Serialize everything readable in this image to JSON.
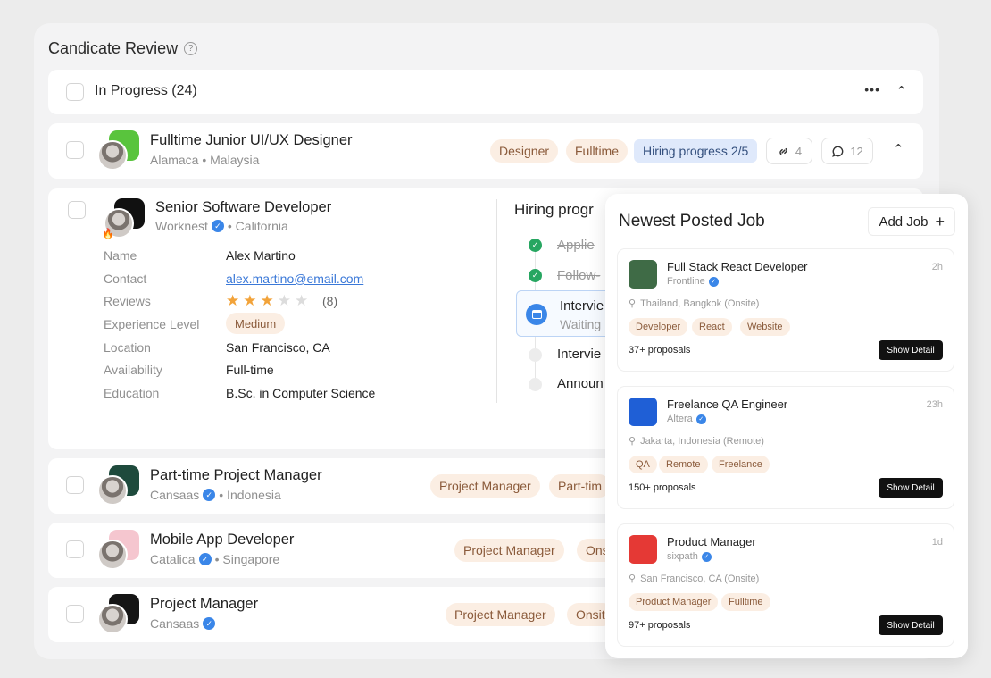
{
  "header": {
    "title": "Candicate Review",
    "help_icon": "?"
  },
  "group": {
    "label": "In Progress (24)",
    "more_icon": "•••",
    "collapse_icon": "⌃"
  },
  "featured": {
    "title": "Fulltime Junior UI/UX Designer",
    "subtitle": "Alamaca • Malaysia",
    "tags": [
      "Designer",
      "Fulltime"
    ],
    "hiring_progress": "Hiring progress 2/5",
    "link_count": "4",
    "comment_count": "12",
    "logo_color": "#59c43d"
  },
  "candidate": {
    "job_title": "Senior Software Developer",
    "company": "Worknest",
    "location": "• California",
    "fields": [
      {
        "label": "Name",
        "value": "Alex Martino"
      },
      {
        "label": "Contact",
        "value": "alex.martino@email.com"
      },
      {
        "label": "Reviews",
        "value": "(8)"
      },
      {
        "label": "Experience Level",
        "value": "Medium"
      },
      {
        "label": "Location",
        "value": "San Francisco, CA"
      },
      {
        "label": "Availability",
        "value": "Full-time"
      },
      {
        "label": "Education",
        "value": "B.Sc. in Computer Science"
      }
    ],
    "rating": 3,
    "rating_max": 5,
    "hiring_title": "Hiring progr",
    "steps": [
      {
        "label": "Applie",
        "status": "done"
      },
      {
        "label": "Follow-",
        "status": "done"
      },
      {
        "label": "Intervie",
        "sub": "Waiting",
        "status": "current"
      },
      {
        "label": "Intervie",
        "status": "pending"
      },
      {
        "label": "Announ",
        "status": "pending"
      }
    ]
  },
  "rows": [
    {
      "title": "Part-time Project Manager",
      "company": "Cansaas",
      "location": "• Indonesia",
      "tags": [
        "Project Manager",
        "Part-tim"
      ],
      "logo_color": "#1e4a3c"
    },
    {
      "title": "Mobile App Developer",
      "company": "Catalica",
      "location": "• Singapore",
      "tags": [
        "Project Manager",
        "Ons"
      ],
      "logo_color": "#f5c6cf"
    },
    {
      "title": "Project Manager",
      "company": "Cansaas",
      "location": "",
      "tags": [
        "Project Manager",
        "Onsit"
      ],
      "logo_color": "#151515"
    }
  ],
  "panel": {
    "title": "Newest Posted Job",
    "add_label": "Add Job",
    "add_icon": "+",
    "jobs": [
      {
        "title": "Full Stack React Developer",
        "company": "Frontline",
        "time": "2h",
        "location": "Thailand, Bangkok (Onsite)",
        "tags": [
          "Developer",
          "React",
          "Website"
        ],
        "proposals": "37+ proposals",
        "button": "Show Detail",
        "logo_color": "#3f6b46"
      },
      {
        "title": "Freelance QA Engineer",
        "company": "Altera",
        "time": "23h",
        "location": "Jakarta, Indonesia (Remote)",
        "tags": [
          "QA",
          "Remote",
          "Freelance"
        ],
        "proposals": "150+ proposals",
        "button": "Show Detail",
        "logo_color": "#1f5fd6"
      },
      {
        "title": "Product Manager",
        "company": "sixpath",
        "time": "1d",
        "location": "San Francisco, CA (Onsite)",
        "tags": [
          "Product Manager",
          "Fulltime"
        ],
        "proposals": "97+ proposals",
        "button": "Show Detail",
        "logo_color": "#e53935"
      }
    ]
  },
  "colors": {
    "accent": "#3a86e8",
    "tag_bg": "#fbeee3",
    "progress_bg": "#dfe9fb",
    "done_green": "#27a661"
  }
}
